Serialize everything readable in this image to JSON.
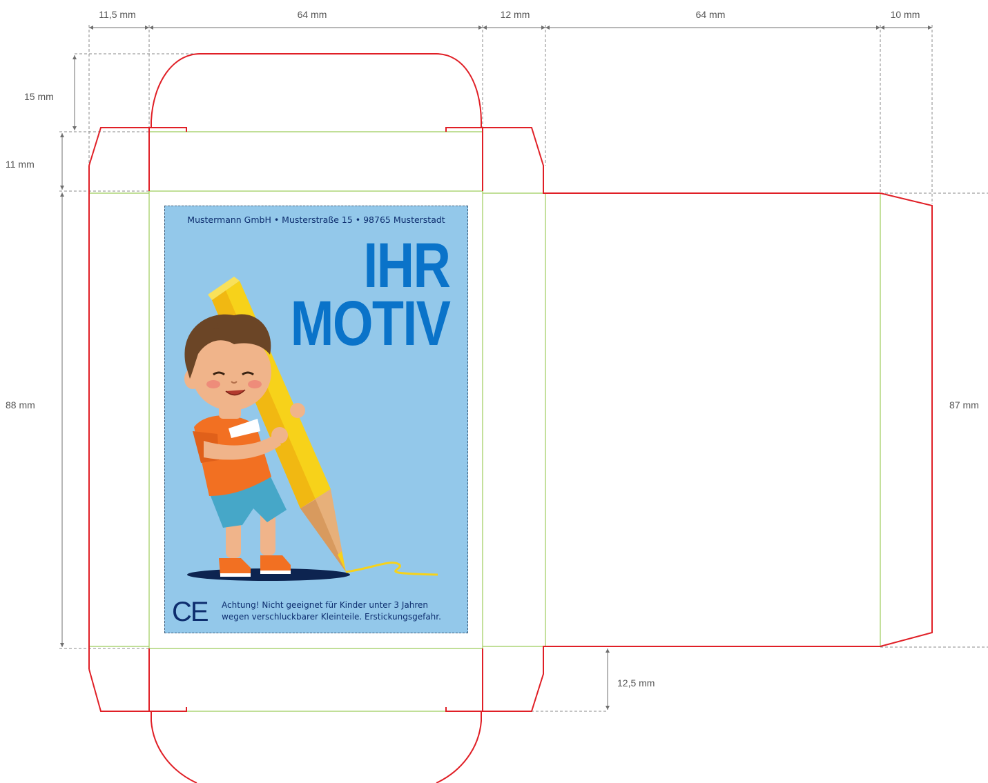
{
  "dimensions": {
    "glue_flap_width": "11,5 mm",
    "front_panel_width": "64 mm",
    "side_panel_width": "12 mm",
    "back_panel_width": "64 mm",
    "end_flap_width": "10 mm",
    "tuck_flap_height": "15 mm",
    "dust_flap_height": "11 mm",
    "panel_height_left": "88 mm",
    "panel_height_right": "87 mm",
    "bottom_flap_height": "12,5 mm"
  },
  "label": {
    "address": "Mustermann GmbH • Musterstraße 15 • 98765 Musterstadt",
    "headline_line1": "IHR",
    "headline_line2": "MOTIV",
    "ce_mark": "CE",
    "warning_line1": "Achtung! Nicht geeignet für Kinder unter 3 Jahren",
    "warning_line2": "wegen verschluckbarer Kleinteile. Erstickungsgefahr."
  },
  "colors": {
    "cut_line": "#e01f26",
    "fold_line": "#9ccc5a",
    "label_background": "#93c8ea",
    "headline": "#0a73c9",
    "text_dark": "#0d2d6e"
  }
}
